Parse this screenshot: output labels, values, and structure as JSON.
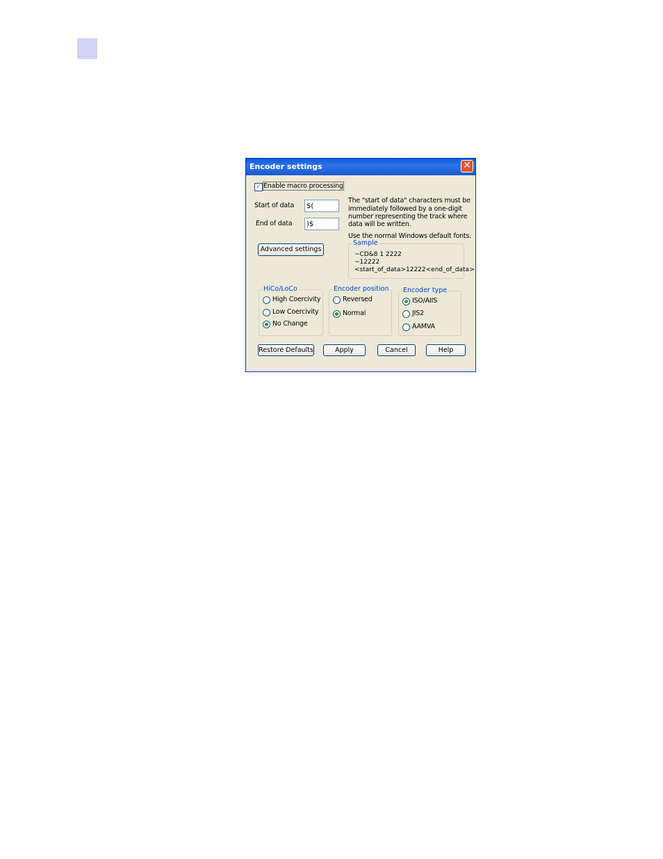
{
  "dialog": {
    "title": "Encoder settings",
    "close_label": "✕",
    "enable_macro": {
      "label": "Enable macro processing",
      "checked": true
    },
    "start_of_data": {
      "label": "Start of data",
      "value": "$("
    },
    "end_of_data": {
      "label": "End of data",
      "value": ")$"
    },
    "info_text_lines": [
      "The \"start of data\" characters must be",
      "immediately followed by a one-digit",
      "number representing the track where",
      "data will be written."
    ],
    "fonts_note": "Use the normal Windows default fonts.",
    "advanced_button": "Advanced settings",
    "sample": {
      "title": "Sample",
      "lines": [
        "~CD&8 1 2222",
        "~12222",
        "<start_of_data>12222<end_of_data>"
      ]
    },
    "hico_group": {
      "title": "HiCo/LoCo",
      "options": [
        "High Coercivity",
        "Low Coercivity",
        "No Change"
      ],
      "selected": "No Change"
    },
    "position_group": {
      "title": "Encoder position",
      "options": [
        "Reversed",
        "Normal"
      ],
      "selected": "Normal"
    },
    "type_group": {
      "title": "Encoder type",
      "options": [
        "ISO/AIIS",
        "JIS2",
        "AAMVA"
      ],
      "selected": "ISO/AIIS"
    },
    "buttons": {
      "restore": "Restore Defaults",
      "apply": "Apply",
      "cancel": "Cancel",
      "help": "Help"
    }
  },
  "colors": {
    "dialog_bg": "#ece9d8",
    "titlebar": "#0a5fd8",
    "group_title": "#0046d5",
    "corner_marker": "#d3d3f5"
  }
}
